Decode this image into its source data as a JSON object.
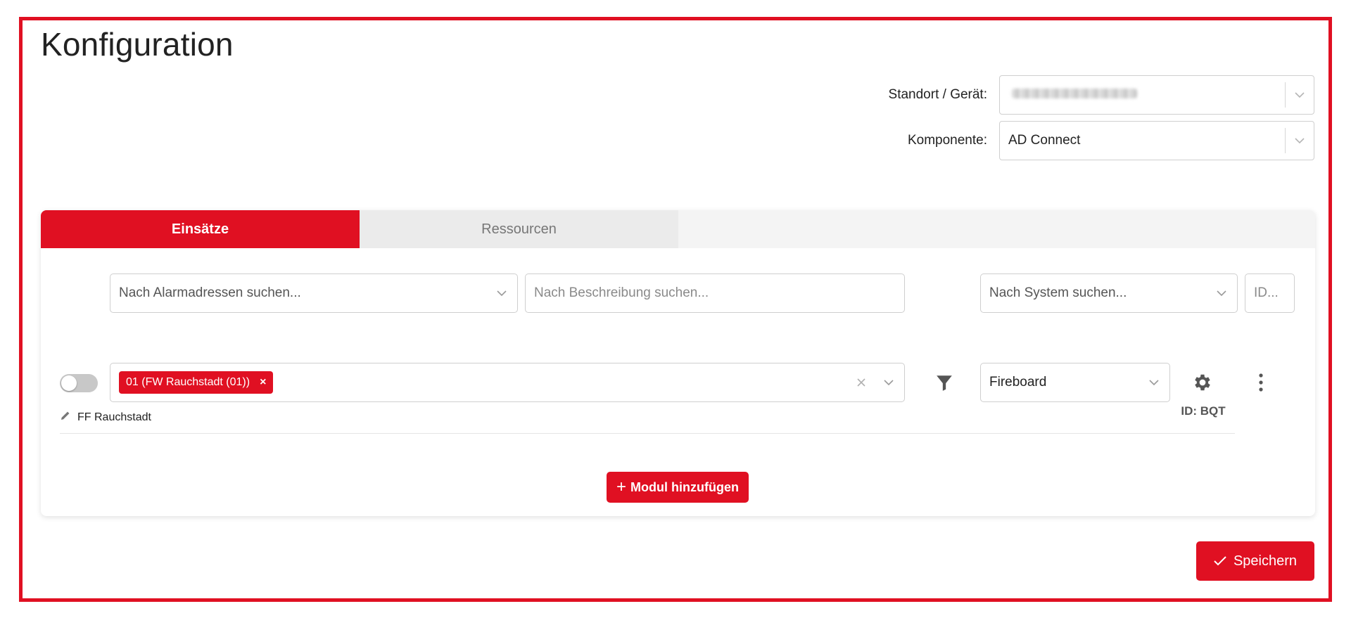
{
  "page": {
    "title": "Konfiguration"
  },
  "config": {
    "location": {
      "label": "Standort / Gerät:",
      "value": ""
    },
    "component": {
      "label": "Komponente:",
      "value": "AD Connect"
    }
  },
  "tabs": [
    {
      "label": "Einsätze",
      "active": true
    },
    {
      "label": "Ressourcen",
      "active": false
    }
  ],
  "filters": {
    "alarm_address": {
      "placeholder": "Nach Alarmadressen suchen..."
    },
    "description": {
      "placeholder": "Nach Beschreibung suchen..."
    },
    "system": {
      "placeholder": "Nach System suchen..."
    },
    "id": {
      "placeholder": "ID..."
    }
  },
  "module": {
    "enabled": false,
    "chips": [
      {
        "label": "01 (FW Rauchstadt (01))",
        "remove": "×"
      }
    ],
    "system": "Fireboard",
    "id_text": "ID: BQT",
    "description": "FF Rauchstadt"
  },
  "actions": {
    "add_module": "Modul hinzufügen",
    "add_symbol": "+",
    "save": "Speichern"
  },
  "colors": {
    "accent": "#e01022",
    "border": "#cfcfcf",
    "tab_bg": "#f4f4f4"
  },
  "icons": [
    "chevron-down-icon",
    "clear-icon",
    "filter-icon",
    "gear-icon",
    "kebab-icon",
    "pencil-icon",
    "check-icon"
  ]
}
